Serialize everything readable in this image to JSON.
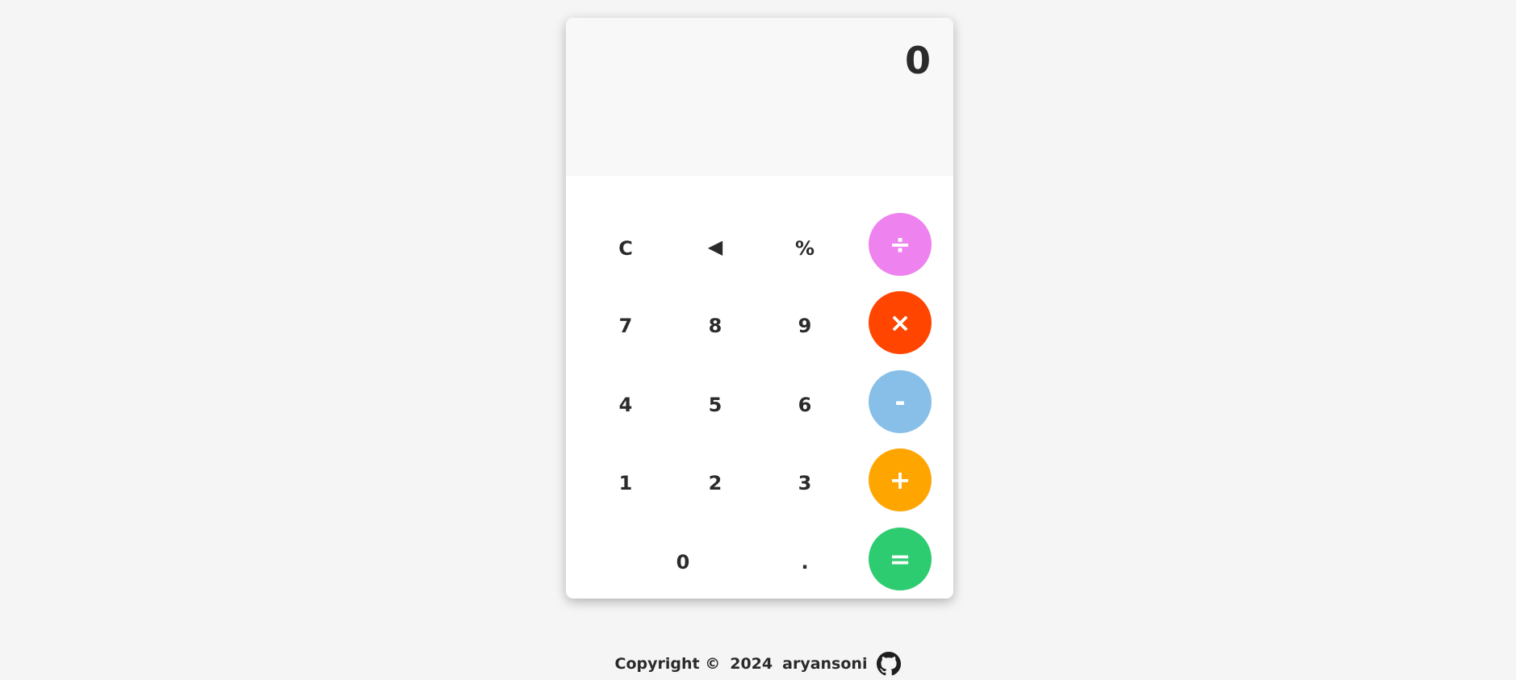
{
  "display": {
    "value": "0"
  },
  "keys": {
    "clear": "C",
    "backspace": "◀",
    "percent": "%",
    "divide": "÷",
    "seven": "7",
    "eight": "8",
    "nine": "9",
    "multiply": "×",
    "four": "4",
    "five": "5",
    "six": "6",
    "subtract": "-",
    "one": "1",
    "two": "2",
    "three": "3",
    "add": "+",
    "zero": "0",
    "decimal": ".",
    "equals": "="
  },
  "colors": {
    "divide": "#ee82ee",
    "multiply": "#ff4500",
    "subtract": "#87bfe8",
    "add": "#ffa500",
    "equals": "#2ecc71"
  },
  "footer": {
    "copyright": "Copyright ©",
    "year": "2024",
    "author": "aryansoni",
    "icon": "github-icon"
  }
}
